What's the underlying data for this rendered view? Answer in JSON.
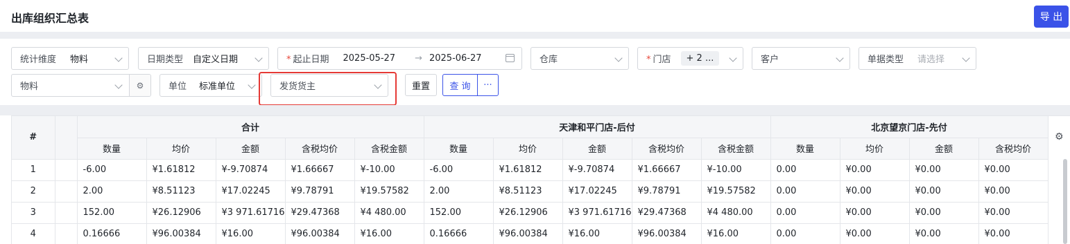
{
  "header": {
    "title": "出库组织汇总表",
    "export_label": "导 出"
  },
  "filters": {
    "dimension": {
      "label": "统计维度",
      "value": "物料"
    },
    "date_type": {
      "label": "日期类型",
      "value": "自定义日期"
    },
    "date_range": {
      "label": "起止日期",
      "start": "2025-05-27",
      "end": "2025-06-27"
    },
    "warehouse": {
      "placeholder": "仓库"
    },
    "store": {
      "label": "门店",
      "tag": "+ 2 ..."
    },
    "customer": {
      "placeholder": "客户"
    },
    "doc_type": {
      "label": "单据类型",
      "placeholder": "请选择"
    },
    "material": {
      "placeholder": "物料"
    },
    "unit": {
      "label": "单位",
      "value": "标准单位"
    },
    "shipper": {
      "placeholder": "发货货主"
    },
    "reset_label": "重置",
    "query_label": "查 询",
    "more_label": "···"
  },
  "table": {
    "index_header": "#",
    "groups": [
      "合计",
      "天津和平门店-后付",
      "北京望京门店-先付"
    ],
    "columns": [
      "数量",
      "均价",
      "金额",
      "含税均价",
      "含税金额"
    ],
    "rows": [
      {
        "idx": "1",
        "cells": [
          "-6.00",
          "¥1.61812",
          "¥-9.70874",
          "¥1.66667",
          "¥-10.00",
          "-6.00",
          "¥1.61812",
          "¥-9.70874",
          "¥1.66667",
          "¥-10.00",
          "0.00",
          "¥0.00",
          "¥0.00",
          "¥0.00"
        ]
      },
      {
        "idx": "2",
        "cells": [
          "2.00",
          "¥8.51123",
          "¥17.02245",
          "¥9.78791",
          "¥19.57582",
          "2.00",
          "¥8.51123",
          "¥17.02245",
          "¥9.78791",
          "¥19.57582",
          "0.00",
          "¥0.00",
          "¥0.00",
          "¥0.00"
        ]
      },
      {
        "idx": "3",
        "cells": [
          "152.00",
          "¥26.12906",
          "¥3 971.61716",
          "¥29.47368",
          "¥4 480.00",
          "152.00",
          "¥26.12906",
          "¥3 971.61716",
          "¥29.47368",
          "¥4 480.00",
          "0.00",
          "¥0.00",
          "¥0.00",
          "¥0.00"
        ]
      },
      {
        "idx": "4",
        "cells": [
          "0.16666",
          "¥96.00384",
          "¥16.00",
          "¥96.00384",
          "¥16.00",
          "0.16666",
          "¥96.00384",
          "¥16.00",
          "¥96.00384",
          "¥16.00",
          "0.00",
          "¥0.00",
          "¥0.00",
          "¥0.00"
        ]
      }
    ]
  },
  "colors": {
    "accent": "#3a52e8",
    "highlight": "#e53935"
  },
  "icons": [
    "chevron-down-icon",
    "calendar-icon",
    "filter-settings-icon",
    "gear-icon"
  ]
}
